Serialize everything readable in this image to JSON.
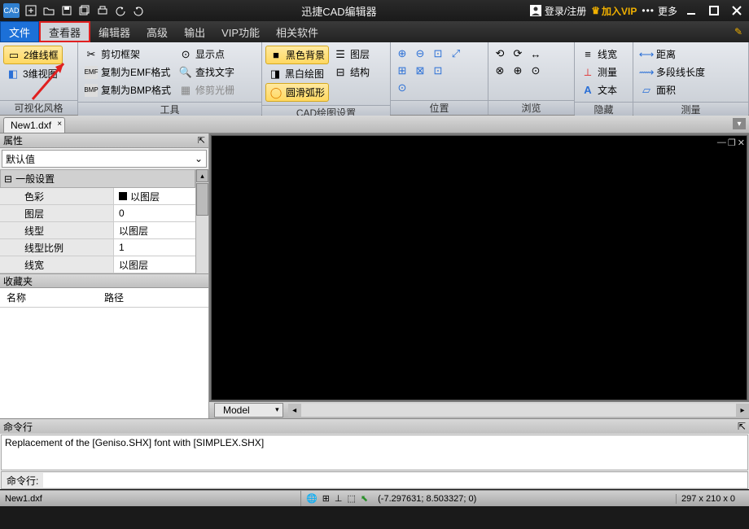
{
  "titlebar": {
    "logo": "CAD",
    "title": "迅捷CAD编辑器",
    "login": "登录/注册",
    "vip": "加入VIP",
    "more": "更多"
  },
  "menu": {
    "file": "文件",
    "viewer": "查看器",
    "editor": "编辑器",
    "advanced": "高级",
    "output": "输出",
    "vip": "VIP功能",
    "related": "相关软件"
  },
  "ribbon": {
    "group1": {
      "btn1": "2维线框",
      "btn2": "3维视图",
      "label": "可视化风格"
    },
    "group2": {
      "btn1": "剪切框架",
      "btn2": "复制为EMF格式",
      "btn3": "复制为BMP格式",
      "btn4": "显示点",
      "btn5": "查找文字",
      "btn6": "修剪光栅",
      "label": "工具"
    },
    "group3": {
      "btn1": "黑色背景",
      "btn2": "黑白绘图",
      "btn3": "圆滑弧形",
      "btn4": "图层",
      "btn5": "结构",
      "label": "CAD绘图设置"
    },
    "group4": {
      "label": "位置"
    },
    "group5": {
      "label": "浏览"
    },
    "group6": {
      "btn1": "线宽",
      "btn2": "测量",
      "btn3": "文本",
      "label": "隐藏"
    },
    "group7": {
      "btn1": "距离",
      "btn2": "多段线长度",
      "btn3": "面积",
      "label": "测量"
    }
  },
  "tabs": {
    "doc1": "New1.dxf"
  },
  "props": {
    "title": "属性",
    "default": "默认值",
    "section1": "一般设置",
    "rows": {
      "color": {
        "k": "色彩",
        "v": "以图层"
      },
      "layer": {
        "k": "图层",
        "v": "0"
      },
      "linetype": {
        "k": "线型",
        "v": "以图层"
      },
      "ltscale": {
        "k": "线型比例",
        "v": "1"
      },
      "lineweight": {
        "k": "线宽",
        "v": "以图层"
      }
    }
  },
  "favorites": {
    "title": "收藏夹",
    "col1": "名称",
    "col2": "路径"
  },
  "model": {
    "tab": "Model"
  },
  "cmd": {
    "title": "命令行",
    "body": "Replacement of the [Geniso.SHX] font with [SIMPLEX.SHX]",
    "label": "命令行:"
  },
  "status": {
    "file": "New1.dxf",
    "coords": "(-7.297631; 8.503327; 0)",
    "dims": "297 x 210 x 0"
  }
}
